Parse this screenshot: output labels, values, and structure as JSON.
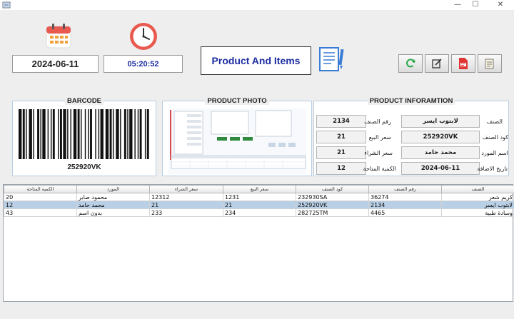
{
  "window": {
    "minimize": "—",
    "maximize": "☐",
    "close": "✕"
  },
  "header": {
    "date": "2024-06-11",
    "time": "05:20:52",
    "title": "Product And Items"
  },
  "toolbar": [
    {
      "name": "refresh-button",
      "icon": "refresh-icon",
      "color": "#2aa84a"
    },
    {
      "name": "edit-button",
      "icon": "edit-icon",
      "color": "#333333"
    },
    {
      "name": "pdf-report-button",
      "icon": "pdf-icon",
      "color": "#e03535"
    },
    {
      "name": "clear-button",
      "icon": "document-icon",
      "color": "#555555"
    }
  ],
  "barcode_panel": {
    "title": "BARCODE",
    "code": "252920VK"
  },
  "photo_panel": {
    "title": "PRODUCT PHOTO"
  },
  "info_panel": {
    "title": "PRODUCT INFORAMTION",
    "fields": {
      "item_name_label": "الصنف",
      "item_name": "لابتوب ايسر",
      "item_no_label": "رقم الصنف",
      "item_no": "2134",
      "item_code_label": "كود الصنف",
      "item_code": "252920VK",
      "sale_price_label": "سعر البيع",
      "sale_price": "21",
      "supplier_label": "اسم المورد",
      "supplier": "محمد حامد",
      "buy_price_label": "سعر الشراء",
      "buy_price": "21",
      "add_date_label": "تاريخ الاضافة",
      "add_date": "2024-06-11",
      "quantity_label": "الكمية المتاحة",
      "quantity": "12"
    }
  },
  "table": {
    "columns": [
      "الكمية المتاحة",
      "المورد",
      "سعر الشراء",
      "سعر البيع",
      "كود الصنف",
      "رقم الصنف",
      "الصنف"
    ],
    "rows": [
      [
        "20",
        "محمود صابر",
        "12312",
        "1231",
        "232930SA",
        "36274",
        "كريم شعر"
      ],
      [
        "12",
        "محمد حامد",
        "21",
        "21",
        "252920VK",
        "2134",
        "لابتوب ايسر"
      ],
      [
        "43",
        "بدون اسم",
        "233",
        "234",
        "282725TM",
        "4465",
        "وسادة طبية"
      ]
    ],
    "selected_row": 1
  }
}
